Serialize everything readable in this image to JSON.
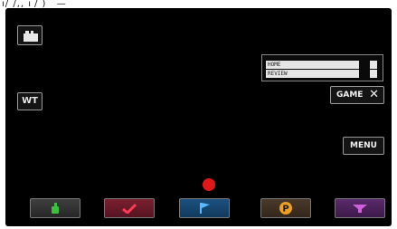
{
  "header": {
    "text": "ı/ /,, ı / )   —"
  },
  "camera": {
    "wt_label": "WT",
    "info_rows": [
      "HOME",
      "REVIEW"
    ],
    "game_label": "GAME",
    "game_close": "✕",
    "menu_label": "MENU",
    "recording_indicator_color": "#e01818",
    "bottom_buttons": [
      {
        "name": "green-mark",
        "color": "#3fbf3f"
      },
      {
        "name": "red-check",
        "color": "#e0304a"
      },
      {
        "name": "blue-flag",
        "color": "#2e90d8"
      },
      {
        "name": "orange-p",
        "color": "#f0a020",
        "label": "P"
      },
      {
        "name": "purple-mark",
        "color": "#b050c0"
      }
    ]
  }
}
